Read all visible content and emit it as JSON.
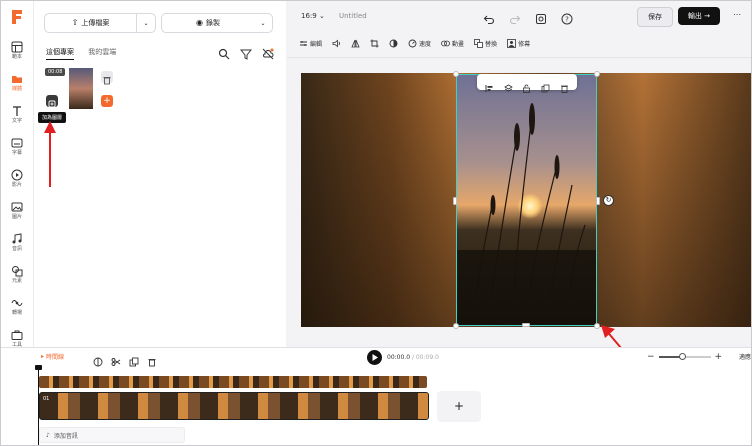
{
  "sidebar": {
    "items": [
      {
        "label": "範本",
        "icon": "template-icon"
      },
      {
        "label": "媒體",
        "icon": "media-icon",
        "active": true
      },
      {
        "label": "文字",
        "icon": "text-icon"
      },
      {
        "label": "字幕",
        "icon": "subtitle-icon"
      },
      {
        "label": "影片",
        "icon": "video-icon"
      },
      {
        "label": "圖片",
        "icon": "image-icon"
      },
      {
        "label": "音訊",
        "icon": "audio-icon"
      },
      {
        "label": "元素",
        "icon": "elements-icon"
      },
      {
        "label": "轉場",
        "icon": "transition-icon"
      },
      {
        "label": "工具",
        "icon": "tools-icon"
      }
    ]
  },
  "panel": {
    "upload_label": "上傳檔案",
    "record_label": "錄製",
    "tabs": [
      {
        "label": "這個專案",
        "active": true
      },
      {
        "label": "我的雲端",
        "active": false
      }
    ],
    "media": {
      "duration": "00:08"
    },
    "tooltip": "加為圖層"
  },
  "topbar": {
    "ratio": "16:9",
    "title": "Untitled",
    "save_label": "保存",
    "export_label": "輸出"
  },
  "edit_toolbar": [
    {
      "label": "編輯",
      "icon": "edit-icon"
    },
    {
      "label": "",
      "icon": "volume-icon"
    },
    {
      "label": "",
      "icon": "flip-icon"
    },
    {
      "label": "",
      "icon": "crop-icon"
    },
    {
      "label": "",
      "icon": "opacity-icon"
    },
    {
      "label": "速度",
      "icon": "speed-icon"
    },
    {
      "label": "動畫",
      "icon": "animation-icon"
    },
    {
      "label": "替換",
      "icon": "replace-icon"
    },
    {
      "label": "修幕",
      "icon": "matting-icon"
    }
  ],
  "timeline": {
    "toggle_label": "時間線",
    "current_time": "00:00.0",
    "total_time": "/ 00:09.0",
    "clip_badge": "01",
    "add_audio_label": "添加音訊",
    "fit_label": "適應",
    "zoom_level": 0.45
  },
  "colors": {
    "brand": "#f26a2e",
    "selection": "#3fd0c8",
    "annotation_arrow": "#e02020"
  }
}
